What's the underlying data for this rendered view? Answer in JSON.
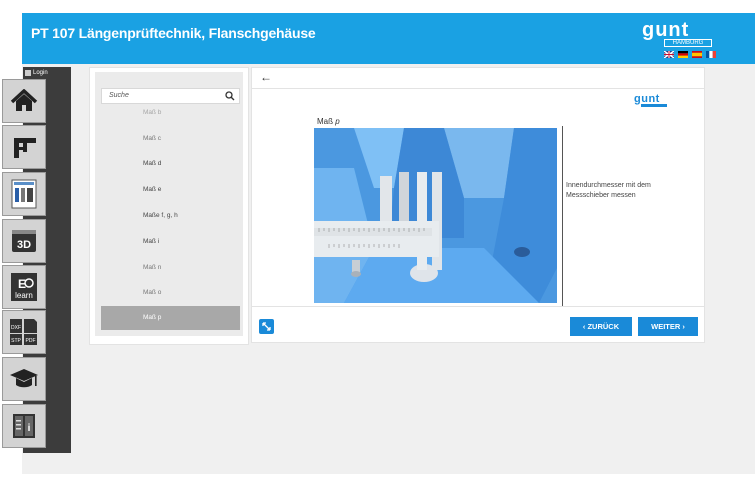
{
  "header": {
    "title": "PT 107 Längenprüftechnik, Flanschgehäuse",
    "logo_text": "gunt",
    "logo_sub": "HAMBURG",
    "languages": [
      "en",
      "de",
      "es",
      "fr"
    ]
  },
  "sidebar": {
    "login_label": "Login",
    "items": [
      {
        "name": "home",
        "icon": "home-icon"
      },
      {
        "name": "caliper",
        "icon": "caliper-icon"
      },
      {
        "name": "document",
        "icon": "document-icon"
      },
      {
        "name": "3d",
        "icon": "3d-icon",
        "label": "3D"
      },
      {
        "name": "elearn",
        "icon": "elearn-icon",
        "label": "E learn"
      },
      {
        "name": "files",
        "icon": "files-icon",
        "labels": [
          "DXF",
          "STP",
          "PDF"
        ]
      },
      {
        "name": "education",
        "icon": "graduation-cap-icon"
      },
      {
        "name": "info",
        "icon": "book-info-icon"
      }
    ]
  },
  "list": {
    "search_placeholder": "Suche",
    "items": [
      "Maß b",
      "Maß c",
      "Maß d",
      "Maß e",
      "Maße f, g, h",
      "Maß i",
      "Maß n",
      "Maß o",
      "Maß p"
    ],
    "selected": "Maß p"
  },
  "main": {
    "title_prefix": "Maß",
    "title_var": "p",
    "description": "Innendurchmesser mit dem Messschieber messen",
    "brand": "gunt",
    "prev_label": "‹ ZURÜCK",
    "next_label": "WEITER ›"
  }
}
